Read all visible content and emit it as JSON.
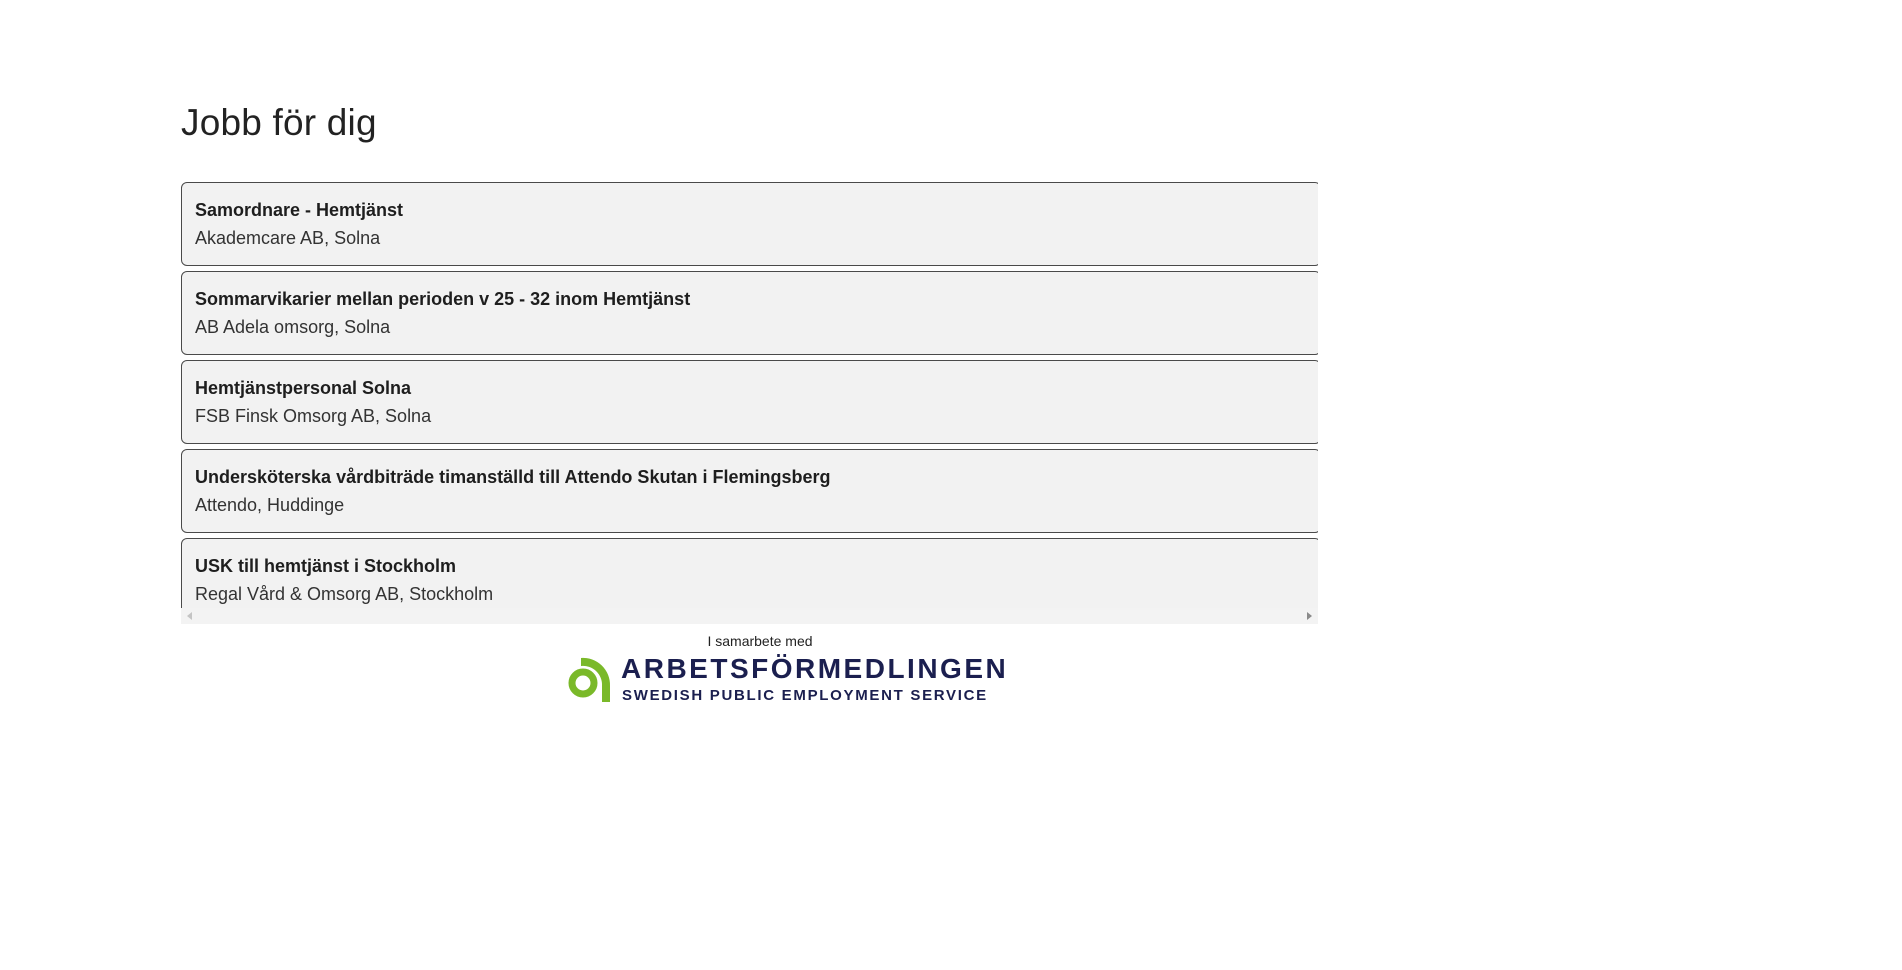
{
  "section": {
    "title": "Jobb för dig"
  },
  "jobs": [
    {
      "title": "Samordnare - Hemtjänst",
      "company": "Akademcare AB, Solna"
    },
    {
      "title": "Sommarvikarier mellan perioden v 25 - 32 inom Hemtjänst",
      "company": "AB Adela omsorg, Solna"
    },
    {
      "title": "Hemtjänstpersonal Solna",
      "company": "FSB Finsk Omsorg AB, Solna"
    },
    {
      "title": "Undersköterska vårdbiträde timanställd till Attendo Skutan i Flemingsberg",
      "company": "Attendo, Huddinge"
    },
    {
      "title": "USK till hemtjänst i Stockholm",
      "company": "Regal Vård & Omsorg AB, Stockholm"
    }
  ],
  "partner": {
    "caption": "I samarbete med",
    "logo_name": "ARBETSFÖRMEDLINGEN",
    "logo_tagline": "SWEDISH PUBLIC EMPLOYMENT SERVICE",
    "logo_icon": "arbetsformedlingen-logo-icon",
    "brand_color": "#1b1f4f",
    "accent_color": "#7ab929"
  },
  "colors": {
    "card_background": "#f2f2f2",
    "card_border": "#4a4a4a"
  }
}
